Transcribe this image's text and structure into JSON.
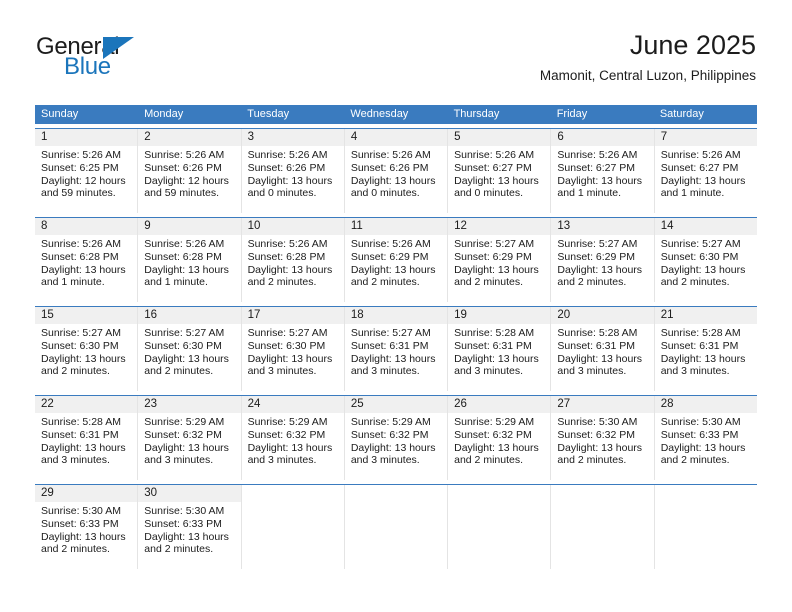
{
  "brand": {
    "name_top": "General",
    "name_bottom": "Blue",
    "accent_color": "#1b75bb"
  },
  "header": {
    "month_title": "June 2025",
    "location": "Mamonit, Central Luzon, Philippines"
  },
  "calendar": {
    "header_bg": "#3a7bbf",
    "daynum_bg": "#f0f0f0",
    "day_names": [
      "Sunday",
      "Monday",
      "Tuesday",
      "Wednesday",
      "Thursday",
      "Friday",
      "Saturday"
    ],
    "weeks": [
      [
        {
          "day": "1",
          "sunrise": "Sunrise: 5:26 AM",
          "sunset": "Sunset: 6:25 PM",
          "daylight_line1": "Daylight: 12 hours",
          "daylight_line2": "and 59 minutes."
        },
        {
          "day": "2",
          "sunrise": "Sunrise: 5:26 AM",
          "sunset": "Sunset: 6:26 PM",
          "daylight_line1": "Daylight: 12 hours",
          "daylight_line2": "and 59 minutes."
        },
        {
          "day": "3",
          "sunrise": "Sunrise: 5:26 AM",
          "sunset": "Sunset: 6:26 PM",
          "daylight_line1": "Daylight: 13 hours",
          "daylight_line2": "and 0 minutes."
        },
        {
          "day": "4",
          "sunrise": "Sunrise: 5:26 AM",
          "sunset": "Sunset: 6:26 PM",
          "daylight_line1": "Daylight: 13 hours",
          "daylight_line2": "and 0 minutes."
        },
        {
          "day": "5",
          "sunrise": "Sunrise: 5:26 AM",
          "sunset": "Sunset: 6:27 PM",
          "daylight_line1": "Daylight: 13 hours",
          "daylight_line2": "and 0 minutes."
        },
        {
          "day": "6",
          "sunrise": "Sunrise: 5:26 AM",
          "sunset": "Sunset: 6:27 PM",
          "daylight_line1": "Daylight: 13 hours",
          "daylight_line2": "and 1 minute."
        },
        {
          "day": "7",
          "sunrise": "Sunrise: 5:26 AM",
          "sunset": "Sunset: 6:27 PM",
          "daylight_line1": "Daylight: 13 hours",
          "daylight_line2": "and 1 minute."
        }
      ],
      [
        {
          "day": "8",
          "sunrise": "Sunrise: 5:26 AM",
          "sunset": "Sunset: 6:28 PM",
          "daylight_line1": "Daylight: 13 hours",
          "daylight_line2": "and 1 minute."
        },
        {
          "day": "9",
          "sunrise": "Sunrise: 5:26 AM",
          "sunset": "Sunset: 6:28 PM",
          "daylight_line1": "Daylight: 13 hours",
          "daylight_line2": "and 1 minute."
        },
        {
          "day": "10",
          "sunrise": "Sunrise: 5:26 AM",
          "sunset": "Sunset: 6:28 PM",
          "daylight_line1": "Daylight: 13 hours",
          "daylight_line2": "and 2 minutes."
        },
        {
          "day": "11",
          "sunrise": "Sunrise: 5:26 AM",
          "sunset": "Sunset: 6:29 PM",
          "daylight_line1": "Daylight: 13 hours",
          "daylight_line2": "and 2 minutes."
        },
        {
          "day": "12",
          "sunrise": "Sunrise: 5:27 AM",
          "sunset": "Sunset: 6:29 PM",
          "daylight_line1": "Daylight: 13 hours",
          "daylight_line2": "and 2 minutes."
        },
        {
          "day": "13",
          "sunrise": "Sunrise: 5:27 AM",
          "sunset": "Sunset: 6:29 PM",
          "daylight_line1": "Daylight: 13 hours",
          "daylight_line2": "and 2 minutes."
        },
        {
          "day": "14",
          "sunrise": "Sunrise: 5:27 AM",
          "sunset": "Sunset: 6:30 PM",
          "daylight_line1": "Daylight: 13 hours",
          "daylight_line2": "and 2 minutes."
        }
      ],
      [
        {
          "day": "15",
          "sunrise": "Sunrise: 5:27 AM",
          "sunset": "Sunset: 6:30 PM",
          "daylight_line1": "Daylight: 13 hours",
          "daylight_line2": "and 2 minutes."
        },
        {
          "day": "16",
          "sunrise": "Sunrise: 5:27 AM",
          "sunset": "Sunset: 6:30 PM",
          "daylight_line1": "Daylight: 13 hours",
          "daylight_line2": "and 2 minutes."
        },
        {
          "day": "17",
          "sunrise": "Sunrise: 5:27 AM",
          "sunset": "Sunset: 6:30 PM",
          "daylight_line1": "Daylight: 13 hours",
          "daylight_line2": "and 3 minutes."
        },
        {
          "day": "18",
          "sunrise": "Sunrise: 5:27 AM",
          "sunset": "Sunset: 6:31 PM",
          "daylight_line1": "Daylight: 13 hours",
          "daylight_line2": "and 3 minutes."
        },
        {
          "day": "19",
          "sunrise": "Sunrise: 5:28 AM",
          "sunset": "Sunset: 6:31 PM",
          "daylight_line1": "Daylight: 13 hours",
          "daylight_line2": "and 3 minutes."
        },
        {
          "day": "20",
          "sunrise": "Sunrise: 5:28 AM",
          "sunset": "Sunset: 6:31 PM",
          "daylight_line1": "Daylight: 13 hours",
          "daylight_line2": "and 3 minutes."
        },
        {
          "day": "21",
          "sunrise": "Sunrise: 5:28 AM",
          "sunset": "Sunset: 6:31 PM",
          "daylight_line1": "Daylight: 13 hours",
          "daylight_line2": "and 3 minutes."
        }
      ],
      [
        {
          "day": "22",
          "sunrise": "Sunrise: 5:28 AM",
          "sunset": "Sunset: 6:31 PM",
          "daylight_line1": "Daylight: 13 hours",
          "daylight_line2": "and 3 minutes."
        },
        {
          "day": "23",
          "sunrise": "Sunrise: 5:29 AM",
          "sunset": "Sunset: 6:32 PM",
          "daylight_line1": "Daylight: 13 hours",
          "daylight_line2": "and 3 minutes."
        },
        {
          "day": "24",
          "sunrise": "Sunrise: 5:29 AM",
          "sunset": "Sunset: 6:32 PM",
          "daylight_line1": "Daylight: 13 hours",
          "daylight_line2": "and 3 minutes."
        },
        {
          "day": "25",
          "sunrise": "Sunrise: 5:29 AM",
          "sunset": "Sunset: 6:32 PM",
          "daylight_line1": "Daylight: 13 hours",
          "daylight_line2": "and 3 minutes."
        },
        {
          "day": "26",
          "sunrise": "Sunrise: 5:29 AM",
          "sunset": "Sunset: 6:32 PM",
          "daylight_line1": "Daylight: 13 hours",
          "daylight_line2": "and 2 minutes."
        },
        {
          "day": "27",
          "sunrise": "Sunrise: 5:30 AM",
          "sunset": "Sunset: 6:32 PM",
          "daylight_line1": "Daylight: 13 hours",
          "daylight_line2": "and 2 minutes."
        },
        {
          "day": "28",
          "sunrise": "Sunrise: 5:30 AM",
          "sunset": "Sunset: 6:33 PM",
          "daylight_line1": "Daylight: 13 hours",
          "daylight_line2": "and 2 minutes."
        }
      ],
      [
        {
          "day": "29",
          "sunrise": "Sunrise: 5:30 AM",
          "sunset": "Sunset: 6:33 PM",
          "daylight_line1": "Daylight: 13 hours",
          "daylight_line2": "and 2 minutes."
        },
        {
          "day": "30",
          "sunrise": "Sunrise: 5:30 AM",
          "sunset": "Sunset: 6:33 PM",
          "daylight_line1": "Daylight: 13 hours",
          "daylight_line2": "and 2 minutes."
        },
        null,
        null,
        null,
        null,
        null
      ]
    ]
  }
}
